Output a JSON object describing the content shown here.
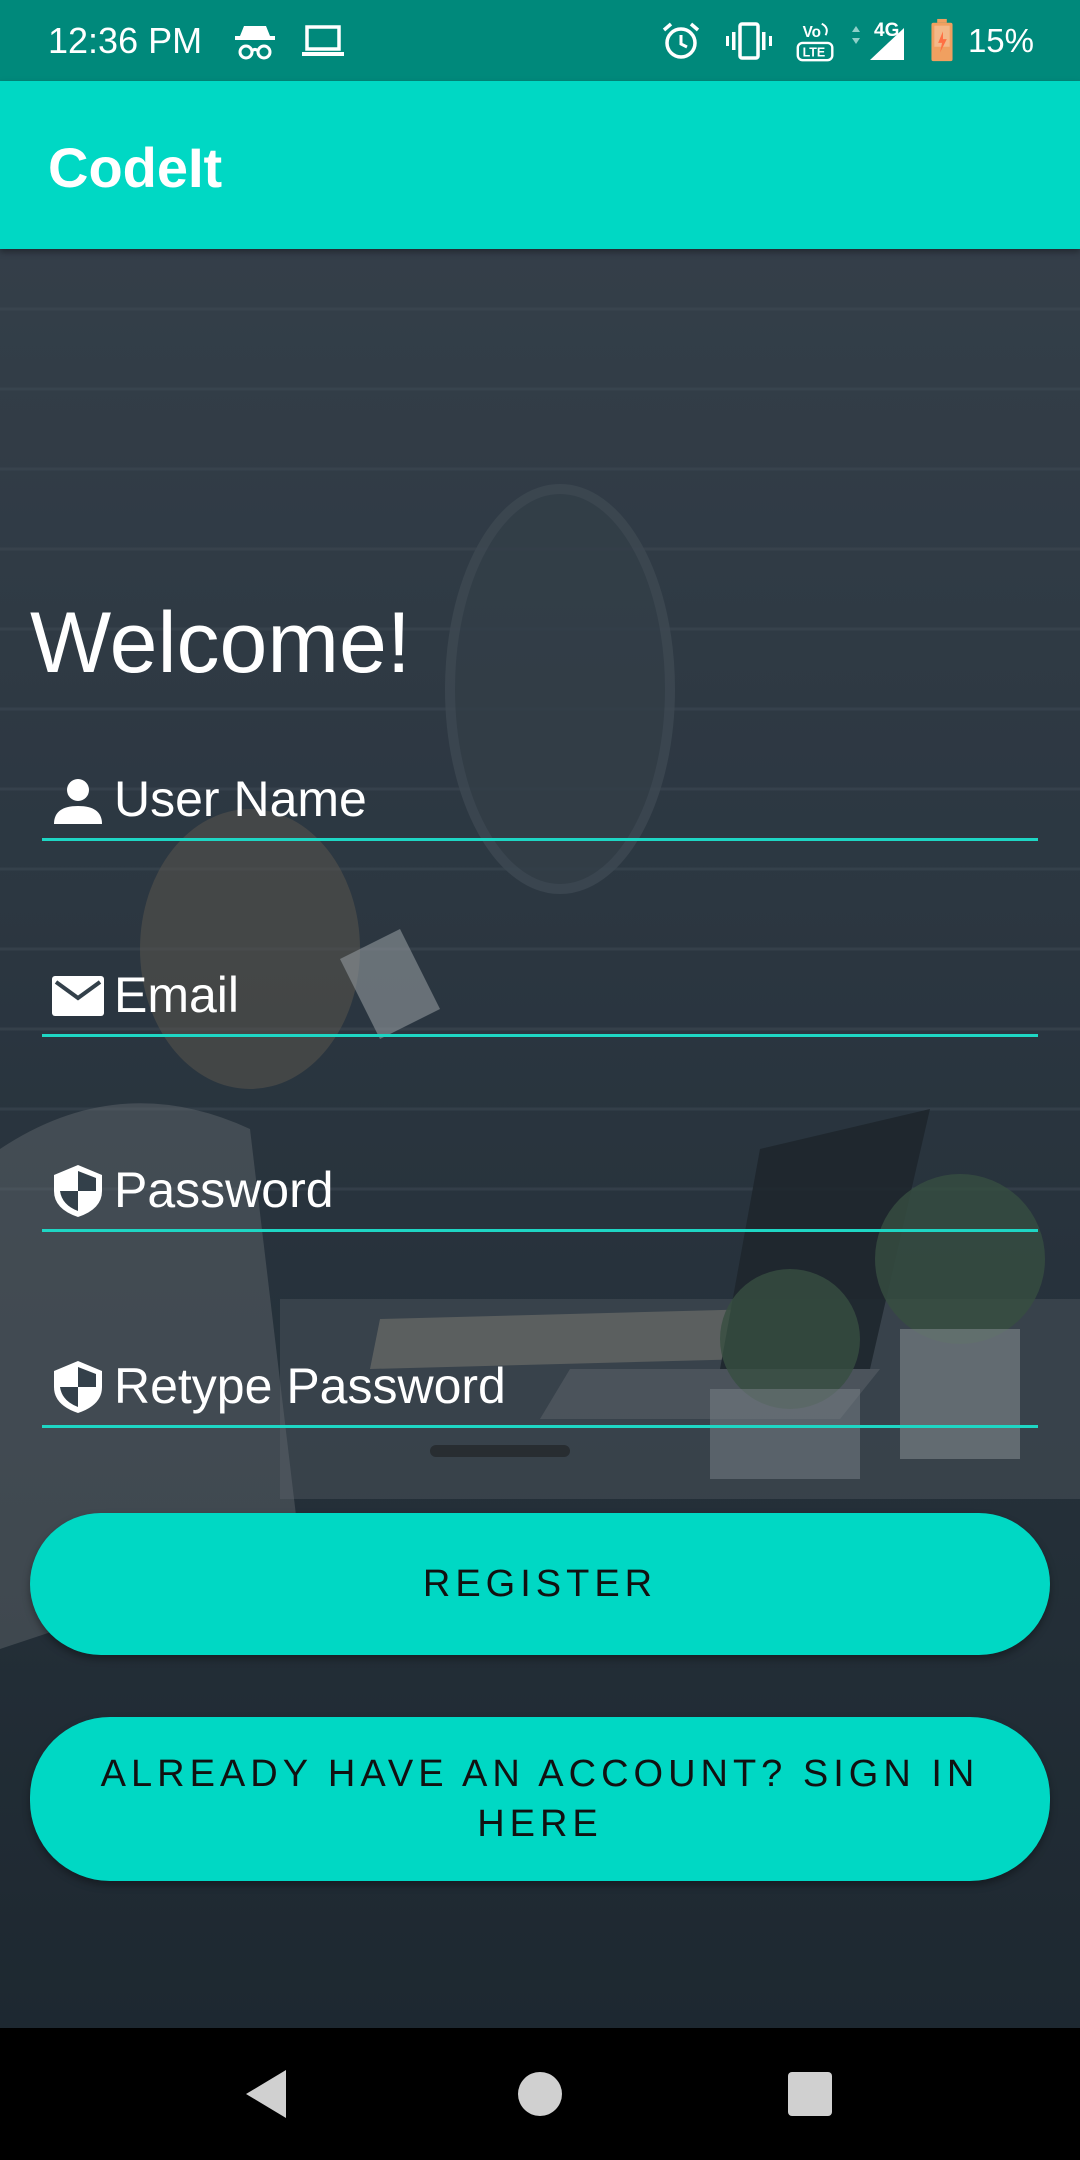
{
  "status_bar": {
    "time": "12:36 PM",
    "battery_percent": "15%",
    "network": "4G",
    "icons": [
      "incognito-icon",
      "laptop-icon",
      "alarm-icon",
      "vibrate-icon",
      "volte-icon",
      "signal-icon",
      "battery-icon"
    ]
  },
  "app_bar": {
    "title": "CodeIt"
  },
  "form": {
    "heading": "Welcome!",
    "fields": [
      {
        "label": "User Name",
        "icon": "person-icon"
      },
      {
        "label": "Email",
        "icon": "mail-icon"
      },
      {
        "label": "Password",
        "icon": "shield-icon"
      },
      {
        "label": "Retype Password",
        "icon": "shield-icon"
      }
    ],
    "register_label": "REGISTER",
    "signin_label_line1": "ALREADY HAVE AN ACCOUNT? SIGN IN",
    "signin_label_line2": "HERE"
  },
  "colors": {
    "accent": "#00d8c4",
    "status_bar": "#00897b",
    "underline": "#1ed6c4"
  },
  "nav_bar": {
    "icons": [
      "back-icon",
      "home-icon",
      "recents-icon"
    ]
  }
}
